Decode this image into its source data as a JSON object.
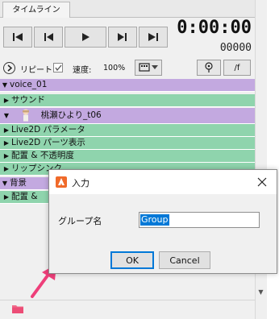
{
  "tab": {
    "label": "タイムライン"
  },
  "transport": {
    "timecode": "0:00:00",
    "frame": "00000"
  },
  "options": {
    "repeat_label": "リピート",
    "speed_label": "速度:",
    "speed_value": "100%",
    "fps_button": "/f"
  },
  "tracks": [
    {
      "label": "voice_01",
      "expand": "▼",
      "color": "purple"
    },
    {
      "label": "サウンド",
      "expand": "▶",
      "color": "green"
    },
    {
      "label": "桃瀬ひより_t06",
      "expand": "▼",
      "color": "purple"
    },
    {
      "label": "Live2D パラメータ",
      "expand": "▶",
      "color": "green"
    },
    {
      "label": "Live2D パーツ表示",
      "expand": "▶",
      "color": "green"
    },
    {
      "label": "配置 & 不透明度",
      "expand": "▶",
      "color": "green"
    },
    {
      "label": "リップシンク",
      "expand": "▶",
      "color": "green"
    },
    {
      "label": "背景",
      "expand": "▼",
      "color": "purple"
    },
    {
      "label": "配置 &",
      "expand": "▶",
      "color": "green"
    }
  ],
  "dialog": {
    "title": "入力",
    "field_label": "グループ名",
    "field_value": "Group",
    "ok": "OK",
    "cancel": "Cancel"
  },
  "colors": {
    "purple_track": "#c3a9e0",
    "green_track": "#8fd4ad",
    "arrow": "#ee3f7a",
    "dialog_icon": "#f06a2a"
  }
}
